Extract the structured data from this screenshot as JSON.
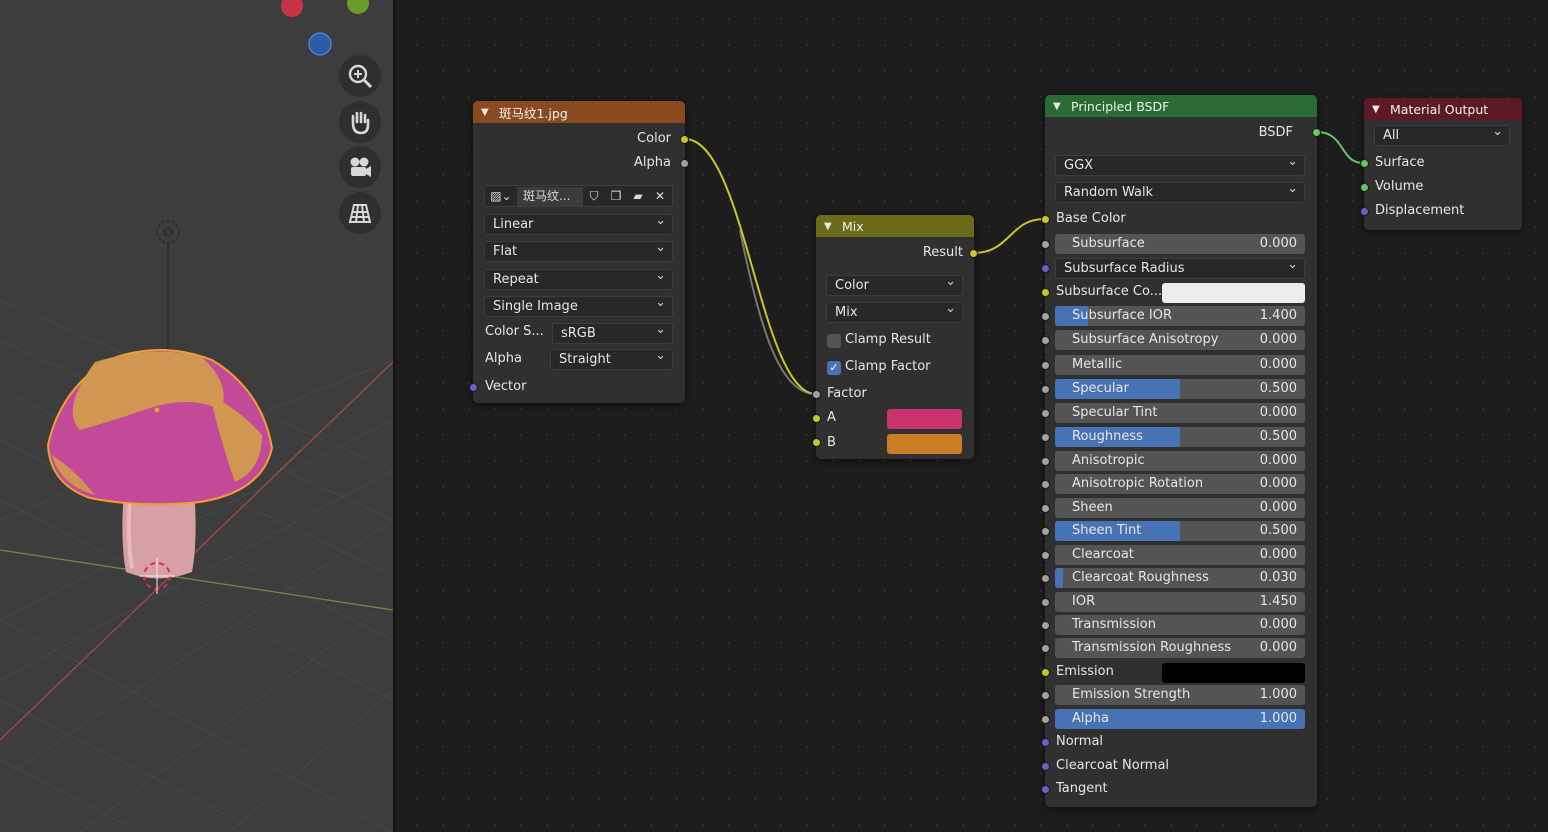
{
  "viewport": {
    "nav_icons": [
      "zoom-icon",
      "hand-pan-icon",
      "camera-icon",
      "ortho-grid-icon"
    ],
    "object_name": "mushroom"
  },
  "image_node": {
    "title": "斑马纹1.jpg",
    "outputs": {
      "color": "Color",
      "alpha": "Alpha"
    },
    "image_name": "斑马纹...",
    "interpolation": "Linear",
    "projection": "Flat",
    "extension": "Repeat",
    "source": "Single Image",
    "color_space_label": "Color S...",
    "color_space": "sRGB",
    "alpha_label": "Alpha",
    "alpha_mode": "Straight",
    "input_vector": "Vector",
    "header_color": "#8a4a1f"
  },
  "mix_node": {
    "title": "Mix",
    "output_result": "Result",
    "data_type": "Color",
    "blend_mode": "Mix",
    "clamp_result_label": "Clamp Result",
    "clamp_result": false,
    "clamp_factor_label": "Clamp Factor",
    "clamp_factor": true,
    "input_factor": "Factor",
    "input_a": "A",
    "input_b": "B",
    "color_a": "#c9336e",
    "color_b": "#c97d27",
    "header_color": "#6b6b1b"
  },
  "bsdf_node": {
    "title": "Principled BSDF",
    "output": "BSDF",
    "distribution": "GGX",
    "subsurface_method": "Random Walk",
    "base_color": "Base Color",
    "subsurface_radius": "Subsurface Radius",
    "subsurface_color_label": "Subsurface Co...",
    "subsurface_color": "#ececec",
    "emission_label": "Emission",
    "emission_color": "#000000",
    "header_color": "#2a6b33",
    "fields": [
      {
        "label": "Subsurface",
        "value": "0.000",
        "fill": 0
      },
      {
        "label": "Subsurface IOR",
        "value": "1.400",
        "fill": 0.13
      },
      {
        "label": "Subsurface Anisotropy",
        "value": "0.000",
        "fill": 0
      },
      {
        "label": "Metallic",
        "value": "0.000",
        "fill": 0
      },
      {
        "label": "Specular",
        "value": "0.500",
        "fill": 0.5
      },
      {
        "label": "Specular Tint",
        "value": "0.000",
        "fill": 0
      },
      {
        "label": "Roughness",
        "value": "0.500",
        "fill": 0.5
      },
      {
        "label": "Anisotropic",
        "value": "0.000",
        "fill": 0
      },
      {
        "label": "Anisotropic Rotation",
        "value": "0.000",
        "fill": 0
      },
      {
        "label": "Sheen",
        "value": "0.000",
        "fill": 0
      },
      {
        "label": "Sheen Tint",
        "value": "0.500",
        "fill": 0.5
      },
      {
        "label": "Clearcoat",
        "value": "0.000",
        "fill": 0
      },
      {
        "label": "Clearcoat Roughness",
        "value": "0.030",
        "fill": 0.03
      },
      {
        "label": "IOR",
        "value": "1.450",
        "fill": 0
      },
      {
        "label": "Transmission",
        "value": "0.000",
        "fill": 0
      },
      {
        "label": "Transmission Roughness",
        "value": "0.000",
        "fill": 0
      },
      {
        "label": "Emission Strength",
        "value": "1.000",
        "fill": 0
      },
      {
        "label": "Alpha",
        "value": "1.000",
        "fill": 1
      }
    ],
    "normal": "Normal",
    "clearcoat_normal": "Clearcoat Normal",
    "tangent": "Tangent"
  },
  "output_node": {
    "title": "Material Output",
    "target": "All",
    "surface": "Surface",
    "volume": "Volume",
    "displacement": "Displacement",
    "header_color": "#5e1a24"
  }
}
